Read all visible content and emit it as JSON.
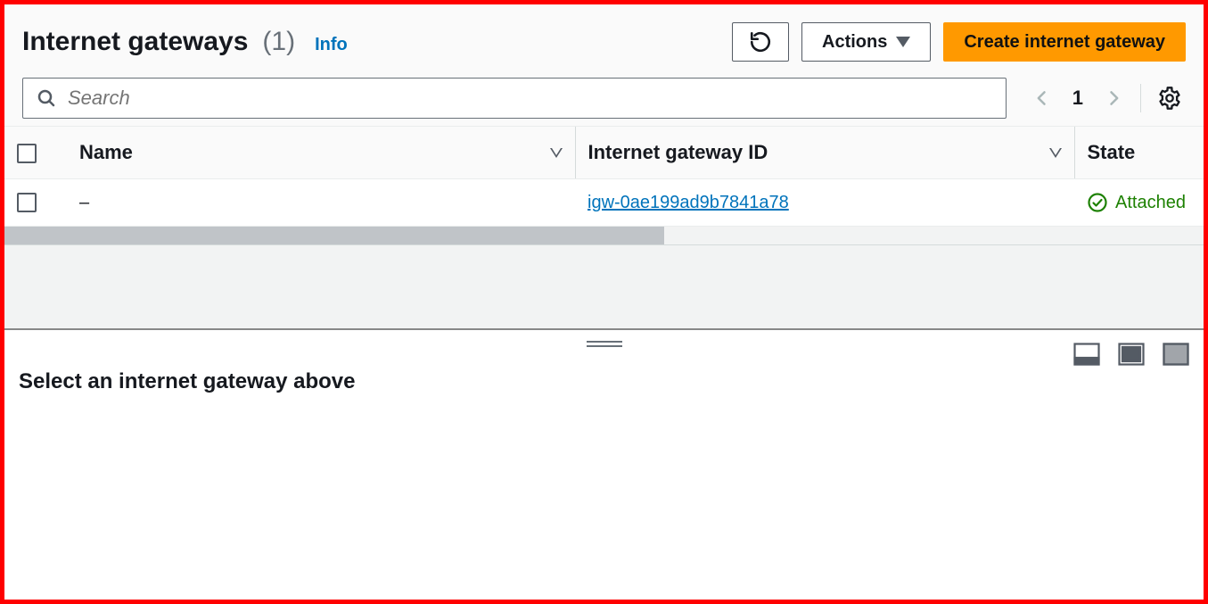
{
  "header": {
    "title": "Internet gateways",
    "count_display": "(1)",
    "info_label": "Info",
    "actions_label": "Actions",
    "create_label": "Create internet gateway"
  },
  "search": {
    "placeholder": "Search"
  },
  "pager": {
    "page": "1"
  },
  "table": {
    "columns": {
      "name": "Name",
      "igw_id": "Internet gateway ID",
      "state": "State"
    },
    "rows": [
      {
        "name": "–",
        "igw_id": "igw-0ae199ad9b7841a78",
        "state": "Attached",
        "selected": false
      }
    ]
  },
  "details": {
    "empty_message": "Select an internet gateway above"
  }
}
